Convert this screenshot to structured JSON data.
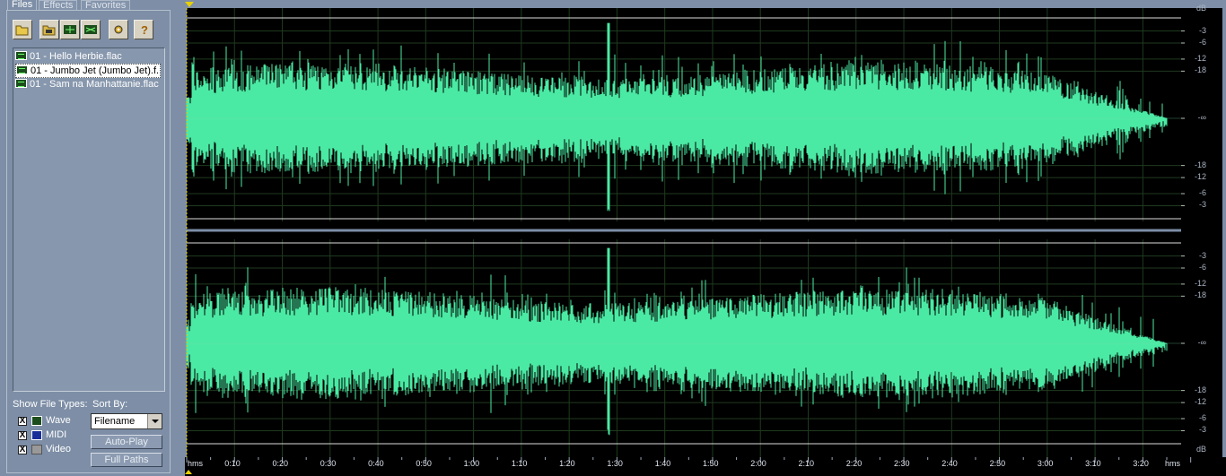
{
  "tabs": [
    "Files",
    "Effects",
    "Favorites"
  ],
  "toolbar": {
    "icons": [
      "open-folder-icon",
      "folder-icon",
      "insert-icon",
      "close-file-icon",
      "options-icon",
      "help-icon"
    ],
    "help_glyph": "?"
  },
  "files": [
    {
      "name": "01 - Hello Herbie.flac",
      "selected": false
    },
    {
      "name": "01 - Jumbo Jet (Jumbo Jet).f...",
      "selected": true
    },
    {
      "name": "01 - Sam na Manhattanie.flac",
      "selected": false
    }
  ],
  "show_file_types": {
    "label": "Show File Types:",
    "items": [
      {
        "label": "Wave",
        "checked": true,
        "icon": "wave-icon"
      },
      {
        "label": "MIDI",
        "checked": true,
        "icon": "midi-icon"
      },
      {
        "label": "Video",
        "checked": true,
        "icon": "video-icon"
      }
    ],
    "check_glyph": "X"
  },
  "sort_by": {
    "label": "Sort By:",
    "value": "Filename"
  },
  "buttons": {
    "autoplay": "Auto-Play",
    "fullpaths": "Full Paths"
  },
  "db_scale": {
    "unit": "dB",
    "top_channel": [
      "-3",
      "-6",
      "-12",
      "-18",
      "-∞",
      "-18",
      "-12",
      "-6",
      "-3"
    ],
    "bottom_channel": [
      "-3",
      "-6",
      "-12",
      "-18",
      "-∞",
      "-18",
      "-12",
      "-6",
      "-3"
    ],
    "bottom_unit": "dB"
  },
  "time_ruler": {
    "unit": "hms",
    "labels": [
      "0:10",
      "0:20",
      "0:30",
      "0:40",
      "0:50",
      "1:00",
      "1:10",
      "1:20",
      "1:30",
      "1:40",
      "1:50",
      "2:00",
      "2:10",
      "2:20",
      "2:30",
      "2:40",
      "2:50",
      "3:00",
      "3:10",
      "3:20"
    ],
    "end_unit": "hms"
  },
  "colors": {
    "waveform": "#4beaa4",
    "background": "#000000",
    "grid": "#1f3a1f",
    "panel": "#7d8ea6"
  }
}
